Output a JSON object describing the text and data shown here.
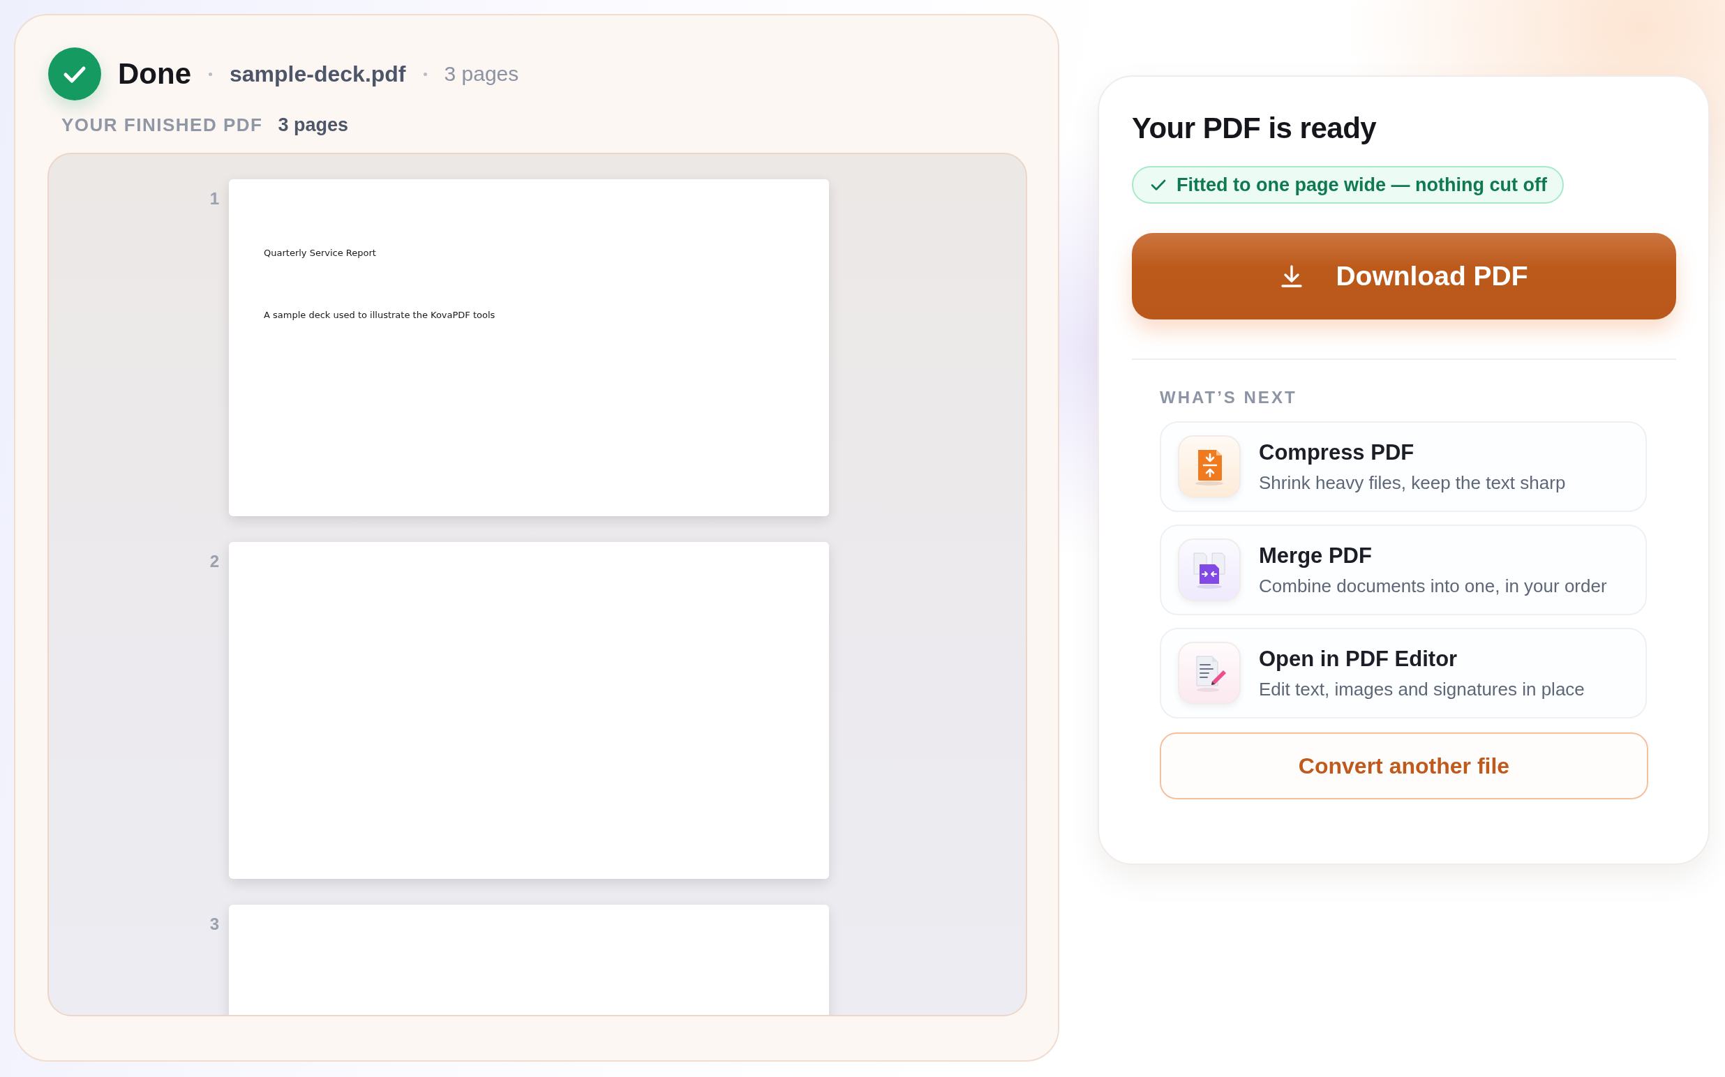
{
  "header": {
    "status": "Done",
    "file_name": "sample-deck.pdf",
    "page_count": "3 pages"
  },
  "preview": {
    "label": "YOUR FINISHED PDF",
    "count": "3 pages",
    "pages": [
      {
        "number": "1",
        "lines": [
          "Quarterly Service Report",
          "A sample deck used to illustrate the KovaPDF tools"
        ]
      },
      {
        "number": "2"
      },
      {
        "number": "3"
      }
    ]
  },
  "result": {
    "title": "Your PDF is ready",
    "badge": "Fitted to one page wide — nothing cut off",
    "download": "Download PDF",
    "next_heading": "WHAT’S NEXT",
    "tools": [
      {
        "kind": "compress",
        "name": "Compress PDF",
        "description": "Shrink heavy files, keep the text sharp"
      },
      {
        "kind": "merge",
        "name": "Merge PDF",
        "description": "Combine documents into one, in your order"
      },
      {
        "kind": "edit",
        "name": "Open in PDF Editor",
        "description": "Edit text, images and signatures in place"
      }
    ],
    "convert": "Convert another file"
  }
}
